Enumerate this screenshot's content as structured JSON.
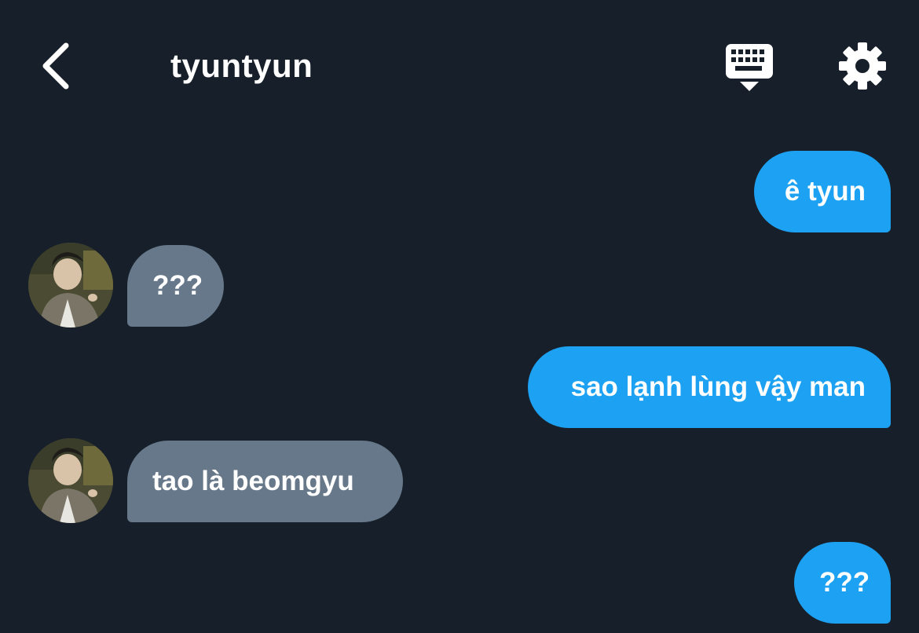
{
  "header": {
    "title": "tyuntyun",
    "back_icon": "chevron-left-icon",
    "keyboard_icon": "keyboard-icon",
    "settings_icon": "gear-icon"
  },
  "colors": {
    "background": "#17202a",
    "sent_bubble": "#1da1f2",
    "received_bubble": "#66788a",
    "text": "#ffffff"
  },
  "messages": [
    {
      "direction": "sent",
      "text": "ê tyun"
    },
    {
      "direction": "received",
      "text": "???"
    },
    {
      "direction": "sent",
      "text": "sao lạnh lùng vậy man"
    },
    {
      "direction": "received",
      "text": "tao là beomgyu"
    },
    {
      "direction": "sent",
      "text": "???"
    }
  ]
}
